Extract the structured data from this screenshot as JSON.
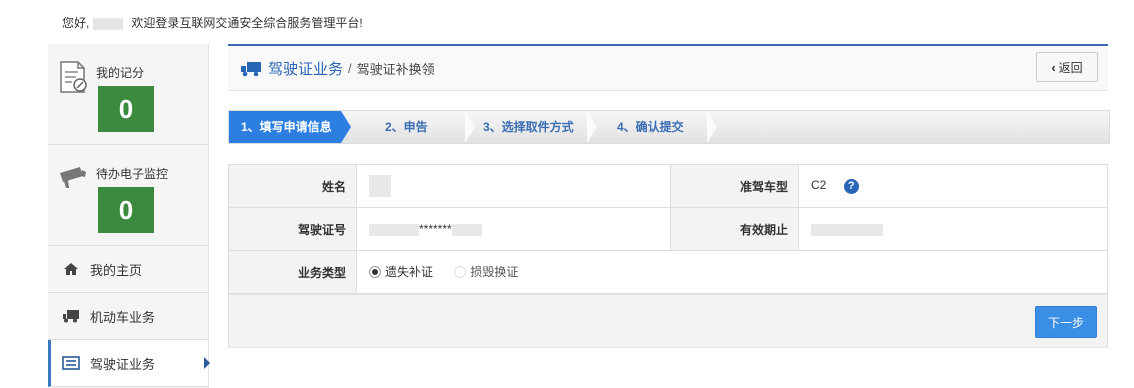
{
  "header": {
    "greeting": "您好,",
    "welcome": "欢迎登录互联网交通安全综合服务管理平台!"
  },
  "sidebar": {
    "stats": [
      {
        "label": "我的记分",
        "value": "0",
        "icon": "score-card-icon"
      },
      {
        "label": "待办电子监控",
        "value": "0",
        "icon": "camera-icon"
      }
    ],
    "items": [
      {
        "label": "我的主页",
        "icon": "home-icon"
      },
      {
        "label": "机动车业务",
        "icon": "truck-icon"
      },
      {
        "label": "驾驶证业务",
        "icon": "id-card-icon"
      }
    ]
  },
  "breadcrumb": {
    "section": "驾驶证业务",
    "separator": "/",
    "page": "驾驶证补换领"
  },
  "back_label": "返回",
  "steps": [
    "1、填写申请信息",
    "2、申告",
    "3、选择取件方式",
    "4、确认提交"
  ],
  "form": {
    "name_label": "姓名",
    "vehicle_type_label": "准驾车型",
    "vehicle_type_value": "C2",
    "license_no_label": "驾驶证号",
    "license_no_value": "*******",
    "valid_until_label": "有效期止",
    "business_type_label": "业务类型",
    "options": [
      "遗失补证",
      "损毁换证"
    ],
    "selected_option": "遗失补证"
  },
  "next_label": "下一步",
  "colors": {
    "accent": "#2c7fe0",
    "brand_blue": "#2a66b6",
    "stat_green": "#3b8a3f"
  }
}
